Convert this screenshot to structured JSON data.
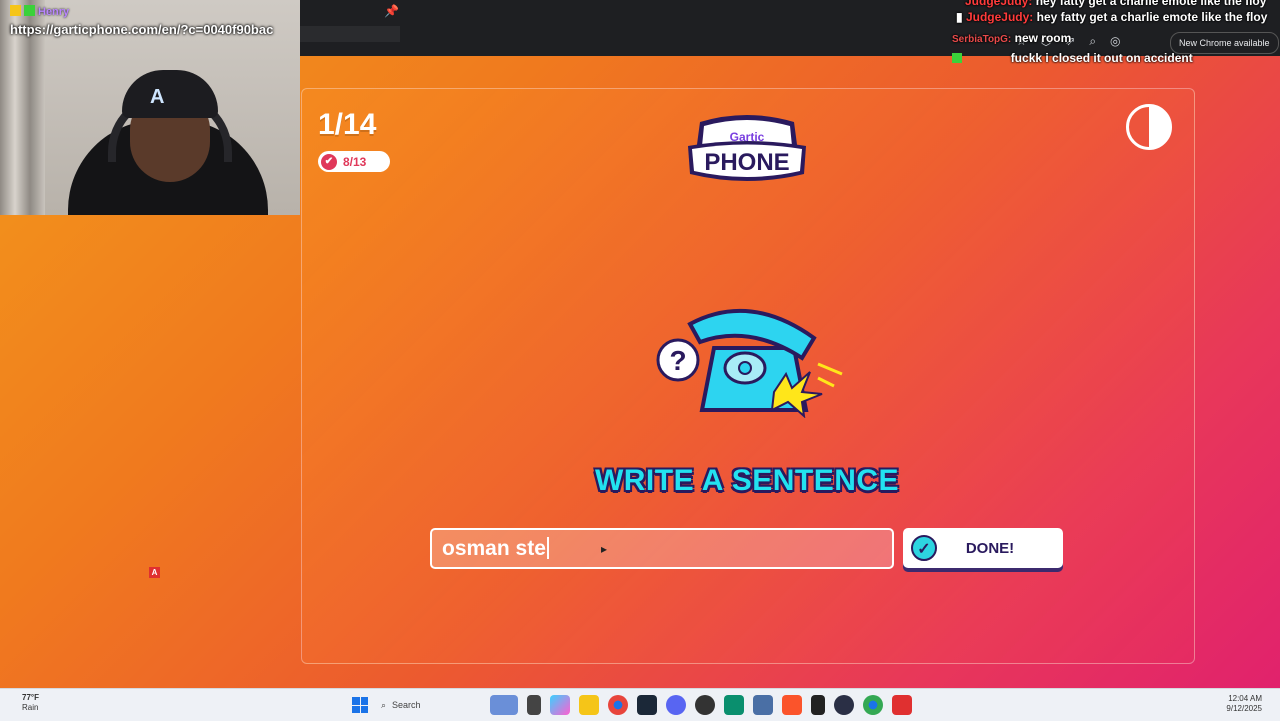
{
  "browser": {
    "update_label": "New Chrome available"
  },
  "stream": {
    "url": "https://garticphone.com/en/?c=0040f90bac",
    "viewer_name": "Henry",
    "chat": [
      {
        "user": "JudgeJudy:",
        "message": "hey fatty get a charlie emote like the floy"
      },
      {
        "user": "JudgeJudy:",
        "message": "hey fatty get a charlie emote like the floy"
      },
      {
        "user": "SerbiaTopG:",
        "message": "new room"
      },
      {
        "user": "",
        "message": "fuckk i closed it out on accident"
      }
    ],
    "badge": "A"
  },
  "game": {
    "round": "1/14",
    "done_count": "8/13",
    "logo_top": "Gartic",
    "logo_bottom": "PHONE",
    "prompt_title": "WRITE A SENTENCE",
    "input_value": "osman ste",
    "done_button": "DONE!"
  },
  "taskbar": {
    "weather_temp": "77°F",
    "weather_cond": "Rain",
    "search_label": "Search",
    "time": "12:04 AM",
    "date": "9/12/2025"
  },
  "colors": {
    "accent_cyan": "#22e2f0",
    "accent_purple": "#2a1a5e",
    "badge_red": "#e0385a"
  }
}
